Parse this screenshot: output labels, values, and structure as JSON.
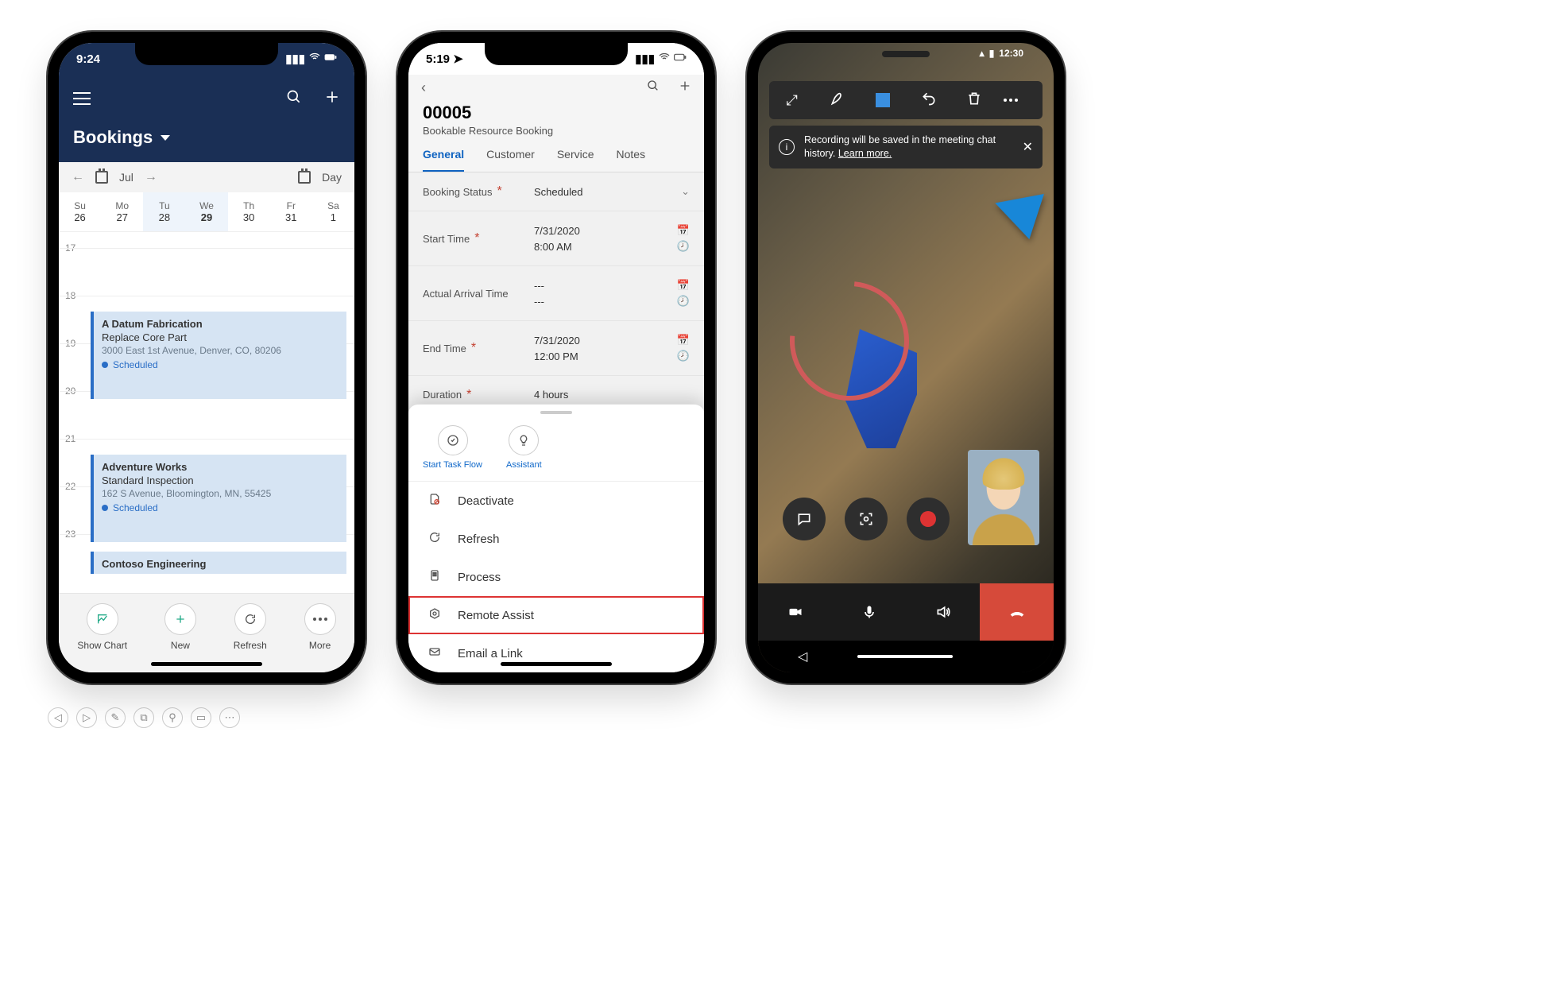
{
  "phone1": {
    "status_time": "9:24",
    "title": "Bookings",
    "month": "Jul",
    "view_label": "Day",
    "week": {
      "days": [
        "Su",
        "Mo",
        "Tu",
        "We",
        "Th",
        "Fr",
        "Sa"
      ],
      "nums": [
        "26",
        "27",
        "28",
        "29",
        "30",
        "31",
        "1"
      ]
    },
    "hours": [
      "17",
      "18",
      "19",
      "20",
      "21",
      "22",
      "23"
    ],
    "events": [
      {
        "title": "A Datum Fabrication",
        "sub": "Replace Core Part",
        "addr": "3000 East 1st Avenue, Denver, CO, 80206",
        "status": "Scheduled"
      },
      {
        "title": "Adventure Works",
        "sub": "Standard Inspection",
        "addr": "162 S Avenue, Bloomington, MN, 55425",
        "status": "Scheduled"
      },
      {
        "title": "Contoso Engineering"
      }
    ],
    "bottom": {
      "chart": "Show Chart",
      "new": "New",
      "refresh": "Refresh",
      "more": "More"
    }
  },
  "phone2": {
    "status_time": "5:19",
    "record_id": "00005",
    "record_type": "Bookable Resource Booking",
    "tabs": [
      "General",
      "Customer",
      "Service",
      "Notes"
    ],
    "fields": {
      "booking_status": {
        "label": "Booking Status",
        "value": "Scheduled"
      },
      "start_time": {
        "label": "Start Time",
        "date": "7/31/2020",
        "time": "8:00 AM"
      },
      "arrival": {
        "label": "Actual Arrival Time",
        "date": "---",
        "time": "---"
      },
      "end_time": {
        "label": "End Time",
        "date": "7/31/2020",
        "time": "12:00 PM"
      },
      "duration": {
        "label": "Duration",
        "value": "4 hours"
      }
    },
    "sheet": {
      "quick": {
        "task": "Start Task Flow",
        "assistant": "Assistant"
      },
      "deactivate": "Deactivate",
      "refresh": "Refresh",
      "process": "Process",
      "remote": "Remote Assist",
      "email": "Email a Link"
    }
  },
  "phone3": {
    "status_time": "12:30",
    "toast": {
      "text": "Recording will be saved in the meeting chat history.",
      "link": "Learn more."
    }
  },
  "pagebar": [
    "◁",
    "▷",
    "✎",
    "⧉",
    "⚲",
    "▭",
    "⋯"
  ]
}
